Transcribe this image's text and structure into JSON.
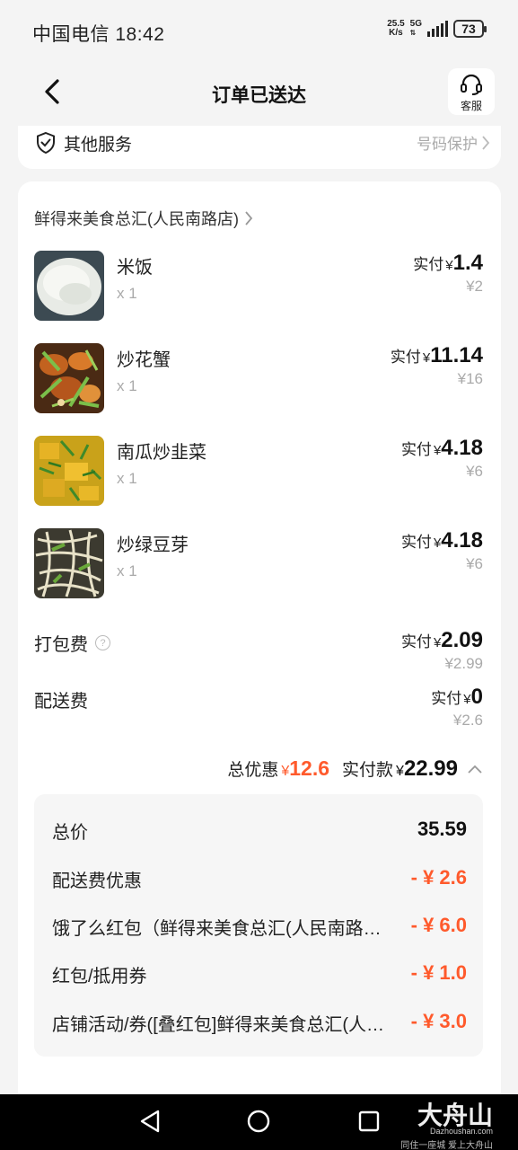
{
  "status_bar": {
    "carrier_time": "中国电信 18:42",
    "net_speed_value": "25.5",
    "net_speed_unit": "K/s",
    "network": "5G",
    "battery": "73"
  },
  "nav": {
    "title": "订单已送达",
    "service_label": "客服"
  },
  "service_card": {
    "label": "其他服务",
    "right_text": "号码保护"
  },
  "store": {
    "name": "鲜得来美食总汇(人民南路店)"
  },
  "items": [
    {
      "name": "米饭",
      "qty": "x 1",
      "paid_label": "实付",
      "currency": "¥",
      "paid": "1.4",
      "original": "¥2"
    },
    {
      "name": "炒花蟹",
      "qty": "x 1",
      "paid_label": "实付",
      "currency": "¥",
      "paid": "11.14",
      "original": "¥16"
    },
    {
      "name": "南瓜炒韭菜",
      "qty": "x 1",
      "paid_label": "实付",
      "currency": "¥",
      "paid": "4.18",
      "original": "¥6"
    },
    {
      "name": "炒绿豆芽",
      "qty": "x 1",
      "paid_label": "实付",
      "currency": "¥",
      "paid": "4.18",
      "original": "¥6"
    }
  ],
  "fees": [
    {
      "label": "打包费",
      "paid_label": "实付",
      "currency": "¥",
      "paid": "2.09",
      "original": "¥2.99",
      "help_icon": "question-icon"
    },
    {
      "label": "配送费",
      "paid_label": "实付",
      "currency": "¥",
      "paid": "0",
      "original": "¥2.6"
    }
  ],
  "totals": {
    "discount_label": "总优惠",
    "discount_currency": "¥",
    "discount_value": "12.6",
    "paid_label": "实付款",
    "paid_currency": "¥",
    "paid_value": "22.99"
  },
  "breakdown": [
    {
      "label": "总价",
      "value": "35.59",
      "red": false
    },
    {
      "label": "配送费优惠",
      "value": "- ¥ 2.6",
      "red": true
    },
    {
      "label": "饿了么红包（鲜得来美食总汇(人民南路店)）",
      "value": "- ¥ 6.0",
      "red": true
    },
    {
      "label": "红包/抵用券",
      "value": "- ¥ 1.0",
      "red": true
    },
    {
      "label": "店铺活动/券([叠红包]鲜得来美食总汇(人民南路店))",
      "value": "- ¥ 3.0",
      "red": true
    }
  ],
  "watermark": {
    "brand": "大舟山",
    "url": "Dazhoushan.com",
    "slogan": "同住一座城 爱上大舟山"
  },
  "colors": {
    "accent_red": "#ff5a2c",
    "background": "#f4f4f4",
    "card": "#ffffff"
  }
}
